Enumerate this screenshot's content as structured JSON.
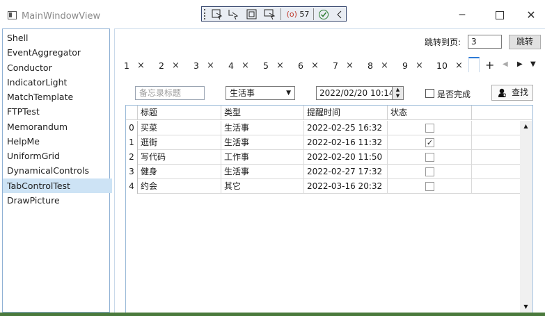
{
  "window": {
    "title": "MainWindowView",
    "minimize": "─",
    "close": "✕"
  },
  "debug_toolbar": {
    "counter": "57",
    "items": [
      "select-element-icon",
      "pointer-icon",
      "frame-icon",
      "cursor-icon",
      "live-icon",
      "check-icon",
      "collapse-icon"
    ]
  },
  "nav": {
    "items": [
      "Shell",
      "EventAggregator",
      "Conductor",
      "IndicatorLight",
      "MatchTemplate",
      "FTPTest",
      "Memorandum",
      "HelpMe",
      "UniformGrid",
      "DynamicalControls",
      "TabControlTest",
      "DrawPicture"
    ],
    "selected": "TabControlTest"
  },
  "jump": {
    "label": "跳转到页:",
    "value": "3",
    "button": "跳转"
  },
  "tabs": {
    "labels": [
      "1",
      "2",
      "3",
      "4",
      "5",
      "6",
      "7",
      "8",
      "9",
      "10"
    ],
    "close": "×",
    "add": "+",
    "left": "◀",
    "right": "▶",
    "menu": "▼"
  },
  "search": {
    "title_placeholder": "备忘录标题",
    "type_value": "生活事",
    "type_arrow": "▼",
    "time_value": "2022/02/20 10:14",
    "spin_up": "▲",
    "spin_down": "▼",
    "done_label": "是否完成",
    "find_label": "查找"
  },
  "grid": {
    "columns": [
      "标题",
      "类型",
      "提醒时间",
      "状态"
    ],
    "rows": [
      {
        "index": "0",
        "title": "买菜",
        "type": "生活事",
        "time": "2022-02-25 16:32",
        "done": false
      },
      {
        "index": "1",
        "title": "逛街",
        "type": "生活事",
        "time": "2022-02-16 11:32",
        "done": true
      },
      {
        "index": "2",
        "title": "写代码",
        "type": "工作事",
        "time": "2022-02-20 11:50",
        "done": false
      },
      {
        "index": "3",
        "title": "健身",
        "type": "生活事",
        "time": "2022-02-27 17:32",
        "done": false
      },
      {
        "index": "4",
        "title": "约会",
        "type": "其它",
        "time": "2022-03-16 20:32",
        "done": false
      }
    ],
    "check_mark": "✓",
    "scroll_up": "▲",
    "scroll_down": "▼"
  }
}
